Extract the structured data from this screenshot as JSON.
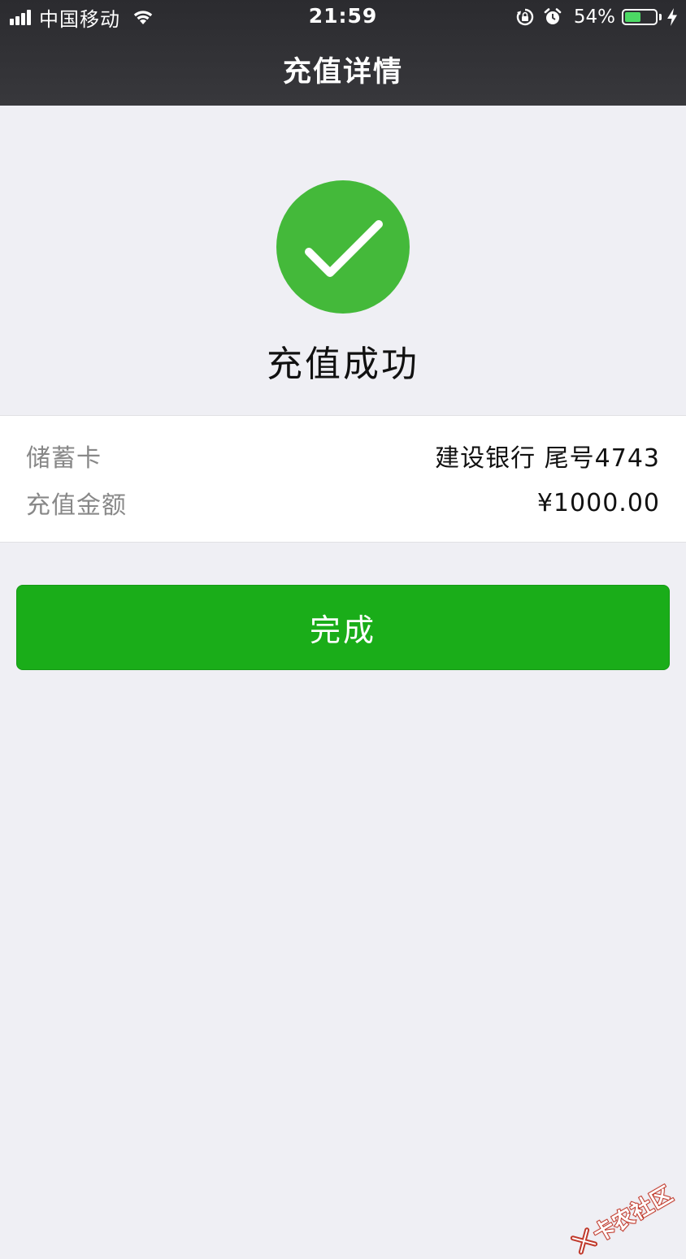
{
  "status_bar": {
    "carrier": "中国移动",
    "time": "21:59",
    "battery_percent": "54%",
    "battery_level": 0.54,
    "icons": [
      "signal-icon",
      "wifi-icon",
      "orientation-lock-icon",
      "alarm-icon",
      "battery-icon",
      "charging-icon"
    ]
  },
  "nav": {
    "title": "充值详情"
  },
  "result": {
    "icon": "check-circle-icon",
    "title": "充值成功"
  },
  "details": {
    "card_label": "储蓄卡",
    "card_value": "建设银行 尾号4743",
    "amount_label": "充值金额",
    "amount_value": "¥1000.00"
  },
  "actions": {
    "done_label": "完成"
  },
  "colors": {
    "success": "#44b93a",
    "button": "#1aad19",
    "nav_bg": "#38383c",
    "page_bg": "#efeff4",
    "battery": "#4cd964"
  },
  "watermark": {
    "text": "卡农社区"
  }
}
